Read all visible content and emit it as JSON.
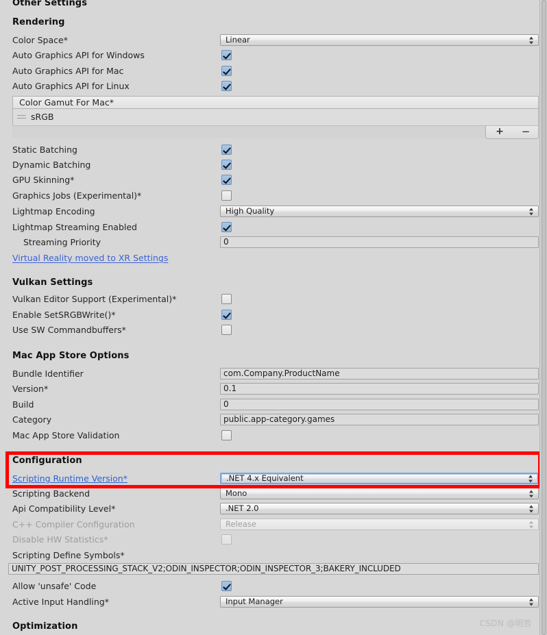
{
  "window": {
    "panel_title": "Other Settings",
    "background_color": "#d7d7d7",
    "highlight_color": "#ff0000",
    "link_color": "#3a62d6"
  },
  "sections": {
    "other_settings": "Other Settings",
    "rendering": "Rendering",
    "vulkan_settings": "Vulkan Settings",
    "mac_app_store_options": "Mac App Store Options",
    "configuration": "Configuration",
    "optimization": "Optimization"
  },
  "rendering": {
    "color_space": {
      "label": "Color Space*",
      "value": "Linear"
    },
    "auto_gfx_windows": {
      "label": "Auto Graphics API  for Windows",
      "checked": true
    },
    "auto_gfx_mac": {
      "label": "Auto Graphics API  for Mac",
      "checked": true
    },
    "auto_gfx_linux": {
      "label": "Auto Graphics API  for Linux",
      "checked": true
    },
    "color_gamut": {
      "label": "Color Gamut For Mac*",
      "items": [
        "sRGB"
      ],
      "add_button": "+",
      "remove_button": "−"
    },
    "static_batching": {
      "label": "Static Batching",
      "checked": true
    },
    "dynamic_batching": {
      "label": "Dynamic Batching",
      "checked": true
    },
    "gpu_skinning": {
      "label": "GPU Skinning*",
      "checked": true
    },
    "graphics_jobs": {
      "label": "Graphics Jobs (Experimental)*",
      "checked": false
    },
    "lightmap_encoding": {
      "label": "Lightmap Encoding",
      "value": "High Quality"
    },
    "lightmap_streaming": {
      "label": "Lightmap Streaming Enabled",
      "checked": true
    },
    "streaming_priority": {
      "label": "Streaming Priority",
      "value": "0"
    },
    "vr_notice": {
      "label": "Virtual Reality moved to XR Settings"
    }
  },
  "vulkan": {
    "editor_support": {
      "label": "Vulkan Editor Support (Experimental)*",
      "checked": false
    },
    "set_srgb_write": {
      "label": "Enable SetSRGBWrite()*",
      "checked": true
    },
    "sw_commandbuffers": {
      "label": "Use SW Commandbuffers*",
      "checked": false
    }
  },
  "mac_app_store": {
    "bundle_identifier": {
      "label": "Bundle Identifier",
      "value": "com.Company.ProductName"
    },
    "version": {
      "label": "Version*",
      "value": "0.1"
    },
    "build": {
      "label": "Build",
      "value": "0"
    },
    "category": {
      "label": "Category",
      "value": "public.app-category.games"
    },
    "validation": {
      "label": "Mac App Store Validation",
      "checked": false
    }
  },
  "configuration": {
    "scripting_runtime_version": {
      "label": "Scripting Runtime Version*",
      "value": ".NET 4.x Equivalent"
    },
    "scripting_backend": {
      "label": "Scripting Backend",
      "value": "Mono"
    },
    "api_compatibility_level": {
      "label": "Api Compatibility Level*",
      "value": ".NET 2.0"
    },
    "cpp_compiler_configuration": {
      "label": "C++ Compiler Configuration",
      "value": "Release"
    },
    "disable_hw_statistics": {
      "label": "Disable HW Statistics*",
      "checked": false
    },
    "scripting_define_symbols": {
      "label": "Scripting Define Symbols*",
      "value": "UNITY_POST_PROCESSING_STACK_V2;ODIN_INSPECTOR;ODIN_INSPECTOR_3;BAKERY_INCLUDED"
    },
    "allow_unsafe_code": {
      "label": "Allow 'unsafe' Code",
      "checked": true
    },
    "active_input_handling": {
      "label": "Active Input Handling*",
      "value": "Input Manager"
    }
  },
  "watermark": "CSDN @明哲"
}
